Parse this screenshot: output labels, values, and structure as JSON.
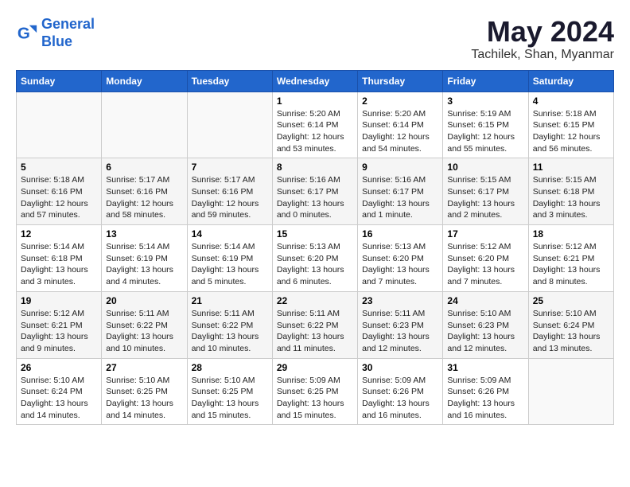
{
  "logo": {
    "line1": "General",
    "line2": "Blue"
  },
  "title": "May 2024",
  "location": "Tachilek, Shan, Myanmar",
  "days_of_week": [
    "Sunday",
    "Monday",
    "Tuesday",
    "Wednesday",
    "Thursday",
    "Friday",
    "Saturday"
  ],
  "weeks": [
    [
      {
        "day": "",
        "info": ""
      },
      {
        "day": "",
        "info": ""
      },
      {
        "day": "",
        "info": ""
      },
      {
        "day": "1",
        "info": "Sunrise: 5:20 AM\nSunset: 6:14 PM\nDaylight: 12 hours\nand 53 minutes."
      },
      {
        "day": "2",
        "info": "Sunrise: 5:20 AM\nSunset: 6:14 PM\nDaylight: 12 hours\nand 54 minutes."
      },
      {
        "day": "3",
        "info": "Sunrise: 5:19 AM\nSunset: 6:15 PM\nDaylight: 12 hours\nand 55 minutes."
      },
      {
        "day": "4",
        "info": "Sunrise: 5:18 AM\nSunset: 6:15 PM\nDaylight: 12 hours\nand 56 minutes."
      }
    ],
    [
      {
        "day": "5",
        "info": "Sunrise: 5:18 AM\nSunset: 6:16 PM\nDaylight: 12 hours\nand 57 minutes."
      },
      {
        "day": "6",
        "info": "Sunrise: 5:17 AM\nSunset: 6:16 PM\nDaylight: 12 hours\nand 58 minutes."
      },
      {
        "day": "7",
        "info": "Sunrise: 5:17 AM\nSunset: 6:16 PM\nDaylight: 12 hours\nand 59 minutes."
      },
      {
        "day": "8",
        "info": "Sunrise: 5:16 AM\nSunset: 6:17 PM\nDaylight: 13 hours\nand 0 minutes."
      },
      {
        "day": "9",
        "info": "Sunrise: 5:16 AM\nSunset: 6:17 PM\nDaylight: 13 hours\nand 1 minute."
      },
      {
        "day": "10",
        "info": "Sunrise: 5:15 AM\nSunset: 6:17 PM\nDaylight: 13 hours\nand 2 minutes."
      },
      {
        "day": "11",
        "info": "Sunrise: 5:15 AM\nSunset: 6:18 PM\nDaylight: 13 hours\nand 3 minutes."
      }
    ],
    [
      {
        "day": "12",
        "info": "Sunrise: 5:14 AM\nSunset: 6:18 PM\nDaylight: 13 hours\nand 3 minutes."
      },
      {
        "day": "13",
        "info": "Sunrise: 5:14 AM\nSunset: 6:19 PM\nDaylight: 13 hours\nand 4 minutes."
      },
      {
        "day": "14",
        "info": "Sunrise: 5:14 AM\nSunset: 6:19 PM\nDaylight: 13 hours\nand 5 minutes."
      },
      {
        "day": "15",
        "info": "Sunrise: 5:13 AM\nSunset: 6:20 PM\nDaylight: 13 hours\nand 6 minutes."
      },
      {
        "day": "16",
        "info": "Sunrise: 5:13 AM\nSunset: 6:20 PM\nDaylight: 13 hours\nand 7 minutes."
      },
      {
        "day": "17",
        "info": "Sunrise: 5:12 AM\nSunset: 6:20 PM\nDaylight: 13 hours\nand 7 minutes."
      },
      {
        "day": "18",
        "info": "Sunrise: 5:12 AM\nSunset: 6:21 PM\nDaylight: 13 hours\nand 8 minutes."
      }
    ],
    [
      {
        "day": "19",
        "info": "Sunrise: 5:12 AM\nSunset: 6:21 PM\nDaylight: 13 hours\nand 9 minutes."
      },
      {
        "day": "20",
        "info": "Sunrise: 5:11 AM\nSunset: 6:22 PM\nDaylight: 13 hours\nand 10 minutes."
      },
      {
        "day": "21",
        "info": "Sunrise: 5:11 AM\nSunset: 6:22 PM\nDaylight: 13 hours\nand 10 minutes."
      },
      {
        "day": "22",
        "info": "Sunrise: 5:11 AM\nSunset: 6:22 PM\nDaylight: 13 hours\nand 11 minutes."
      },
      {
        "day": "23",
        "info": "Sunrise: 5:11 AM\nSunset: 6:23 PM\nDaylight: 13 hours\nand 12 minutes."
      },
      {
        "day": "24",
        "info": "Sunrise: 5:10 AM\nSunset: 6:23 PM\nDaylight: 13 hours\nand 12 minutes."
      },
      {
        "day": "25",
        "info": "Sunrise: 5:10 AM\nSunset: 6:24 PM\nDaylight: 13 hours\nand 13 minutes."
      }
    ],
    [
      {
        "day": "26",
        "info": "Sunrise: 5:10 AM\nSunset: 6:24 PM\nDaylight: 13 hours\nand 14 minutes."
      },
      {
        "day": "27",
        "info": "Sunrise: 5:10 AM\nSunset: 6:25 PM\nDaylight: 13 hours\nand 14 minutes."
      },
      {
        "day": "28",
        "info": "Sunrise: 5:10 AM\nSunset: 6:25 PM\nDaylight: 13 hours\nand 15 minutes."
      },
      {
        "day": "29",
        "info": "Sunrise: 5:09 AM\nSunset: 6:25 PM\nDaylight: 13 hours\nand 15 minutes."
      },
      {
        "day": "30",
        "info": "Sunrise: 5:09 AM\nSunset: 6:26 PM\nDaylight: 13 hours\nand 16 minutes."
      },
      {
        "day": "31",
        "info": "Sunrise: 5:09 AM\nSunset: 6:26 PM\nDaylight: 13 hours\nand 16 minutes."
      },
      {
        "day": "",
        "info": ""
      }
    ]
  ]
}
